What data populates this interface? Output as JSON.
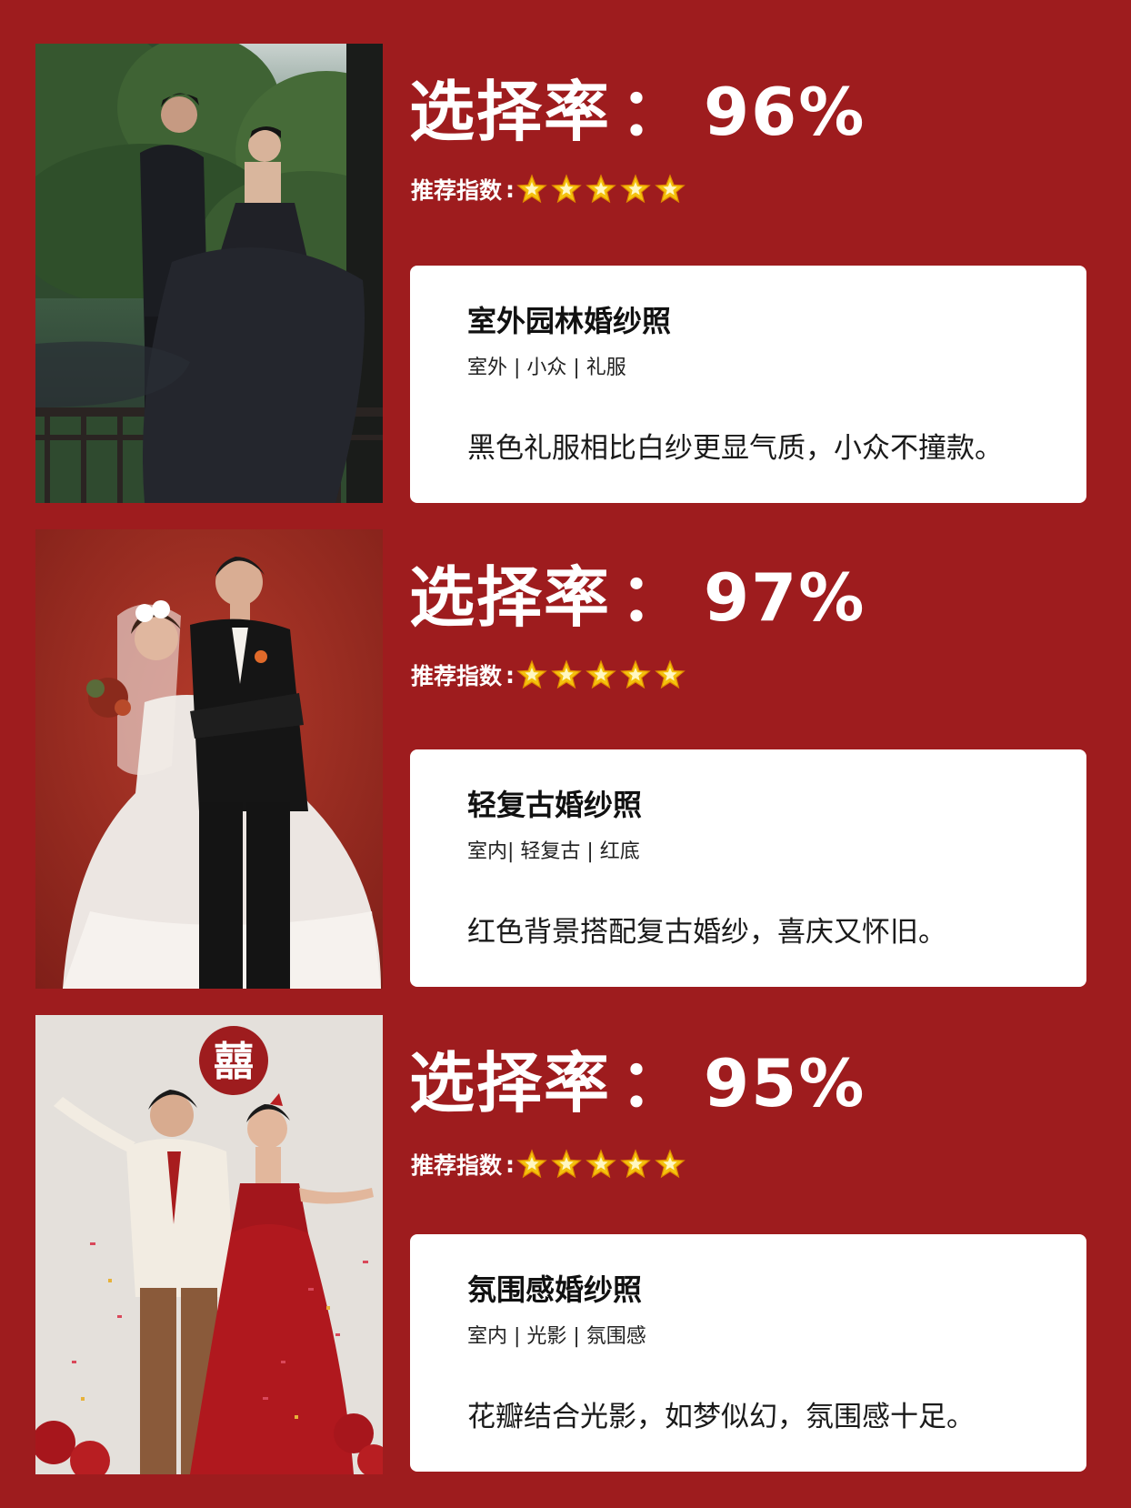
{
  "colors": {
    "background": "#9e1c1e",
    "card": "#ffffff",
    "heading": "#ffffff",
    "star": "#f4c20d"
  },
  "items": [
    {
      "rate_label": "选择率",
      "rate_sep": "：",
      "rate_value": "96%",
      "recommend_label": "推荐指数",
      "recommend_sep": ":",
      "stars": 5,
      "title": "室外园林婚纱照",
      "tags": "室外 | 小众 | 礼服",
      "description": "黑色礼服相比白纱更显气质，小众不撞款。"
    },
    {
      "rate_label": "选择率",
      "rate_sep": "：",
      "rate_value": "97%",
      "recommend_label": "推荐指数",
      "recommend_sep": ":",
      "stars": 5,
      "title": "轻复古婚纱照",
      "tags": "室内| 轻复古 | 红底",
      "description": "红色背景搭配复古婚纱，喜庆又怀旧。"
    },
    {
      "rate_label": "选择率",
      "rate_sep": "：",
      "rate_value": "95%",
      "recommend_label": "推荐指数",
      "recommend_sep": ":",
      "stars": 5,
      "title": "氛围感婚纱照",
      "tags": "室内 | 光影 | 氛围感",
      "description": "花瓣结合光影，如梦似幻，氛围感十足。"
    }
  ],
  "photos": [
    {
      "name": "wedding-photo-garden",
      "icon": "couple-black-gown-garden"
    },
    {
      "name": "wedding-photo-retro",
      "icon": "couple-white-gown-red-backdrop"
    },
    {
      "name": "wedding-photo-ambience",
      "icon": "couple-red-gown-confetti"
    }
  ],
  "photo_decor": {
    "double_happiness": "囍"
  }
}
